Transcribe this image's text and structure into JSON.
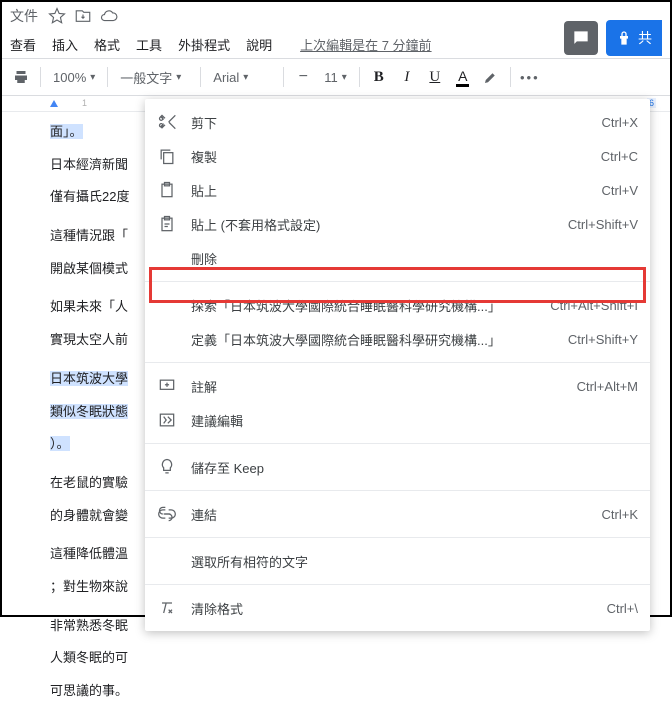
{
  "header": {
    "title": "文件",
    "menus": [
      "查看",
      "插入",
      "格式",
      "工具",
      "外掛程式",
      "說明"
    ],
    "lastedit": "上次編輯是在 7 分鐘前",
    "share": "共"
  },
  "toolbar": {
    "zoom": "100%",
    "style": "一般文字",
    "font": "Arial",
    "size": "11"
  },
  "ruler": {
    "m1": "1",
    "rmark": "6"
  },
  "doc": {
    "l0": "面」。",
    "l1": "日本經濟新聞",
    "l2": "僅有攝氏22度",
    "l3": "這種情況跟「",
    "l4": "開啟某個模式",
    "l5": "如果未來「人",
    "l6": "實現太空人前",
    "l7": "日本筑波大學",
    "l8": "類似冬眠狀態",
    "l9": "）。",
    "l10": "在老鼠的實驗",
    "l11": "的身體就會變",
    "l12": "這種降低體溫",
    "l13": "；對生物來說",
    "l14": "非常熟悉冬眠",
    "l15": "人類冬眠的可",
    "l16": "可思議的事。"
  },
  "ctx": {
    "cut": {
      "label": "剪下",
      "sc": "Ctrl+X"
    },
    "copy": {
      "label": "複製",
      "sc": "Ctrl+C"
    },
    "paste": {
      "label": "貼上",
      "sc": "Ctrl+V"
    },
    "pastenf": {
      "label": "貼上 (不套用格式設定)",
      "sc": "Ctrl+Shift+V"
    },
    "delete": {
      "label": "刪除"
    },
    "explore": {
      "label": "探索「日本筑波大學國際統合睡眠醫科學研究機構...」",
      "sc": "Ctrl+Alt+Shift+I"
    },
    "define": {
      "label": "定義「日本筑波大學國際統合睡眠醫科學研究機構...」",
      "sc": "Ctrl+Shift+Y"
    },
    "comment": {
      "label": "註解",
      "sc": "Ctrl+Alt+M"
    },
    "suggest": {
      "label": "建議編輯"
    },
    "keep": {
      "label": "儲存至 Keep"
    },
    "link": {
      "label": "連結",
      "sc": "Ctrl+K"
    },
    "selectall": {
      "label": "選取所有相符的文字"
    },
    "clearfmt": {
      "label": "清除格式",
      "sc": "Ctrl+\\"
    }
  }
}
